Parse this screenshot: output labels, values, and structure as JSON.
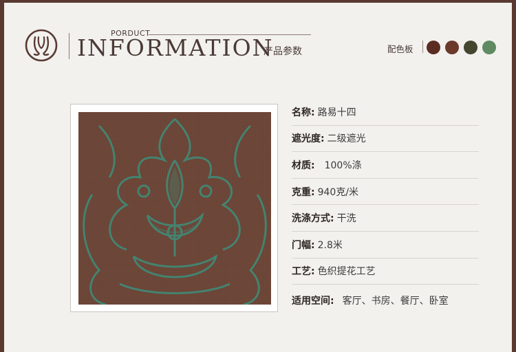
{
  "header": {
    "over_title": "PORDUCT",
    "title": "INFORMATION",
    "subtitle": "产品参数"
  },
  "palette": {
    "label": "配色板",
    "colors": [
      "#5a2c22",
      "#6b3a2b",
      "#44472f",
      "#5f8a62"
    ]
  },
  "logo": {
    "icon": "curtain-monogram-icon",
    "color": "#5a3a34"
  },
  "product_image": {
    "description_icon": "damask-fabric-swatch"
  },
  "specs": [
    {
      "label": "名称:",
      "value": "路易十四"
    },
    {
      "label": "遮光度:",
      "value": "二级遮光"
    },
    {
      "label": "材质:",
      "value": "100%涤"
    },
    {
      "label": "克重:",
      "value": "940克/米"
    },
    {
      "label": "洗涤方式:",
      "value": "干洗"
    },
    {
      "label": "门幅:",
      "value": "2.8米"
    },
    {
      "label": "工艺:",
      "value": "色织提花工艺"
    },
    {
      "label": "适用空间:",
      "value": "客厅、书房、餐厅、卧室"
    }
  ]
}
